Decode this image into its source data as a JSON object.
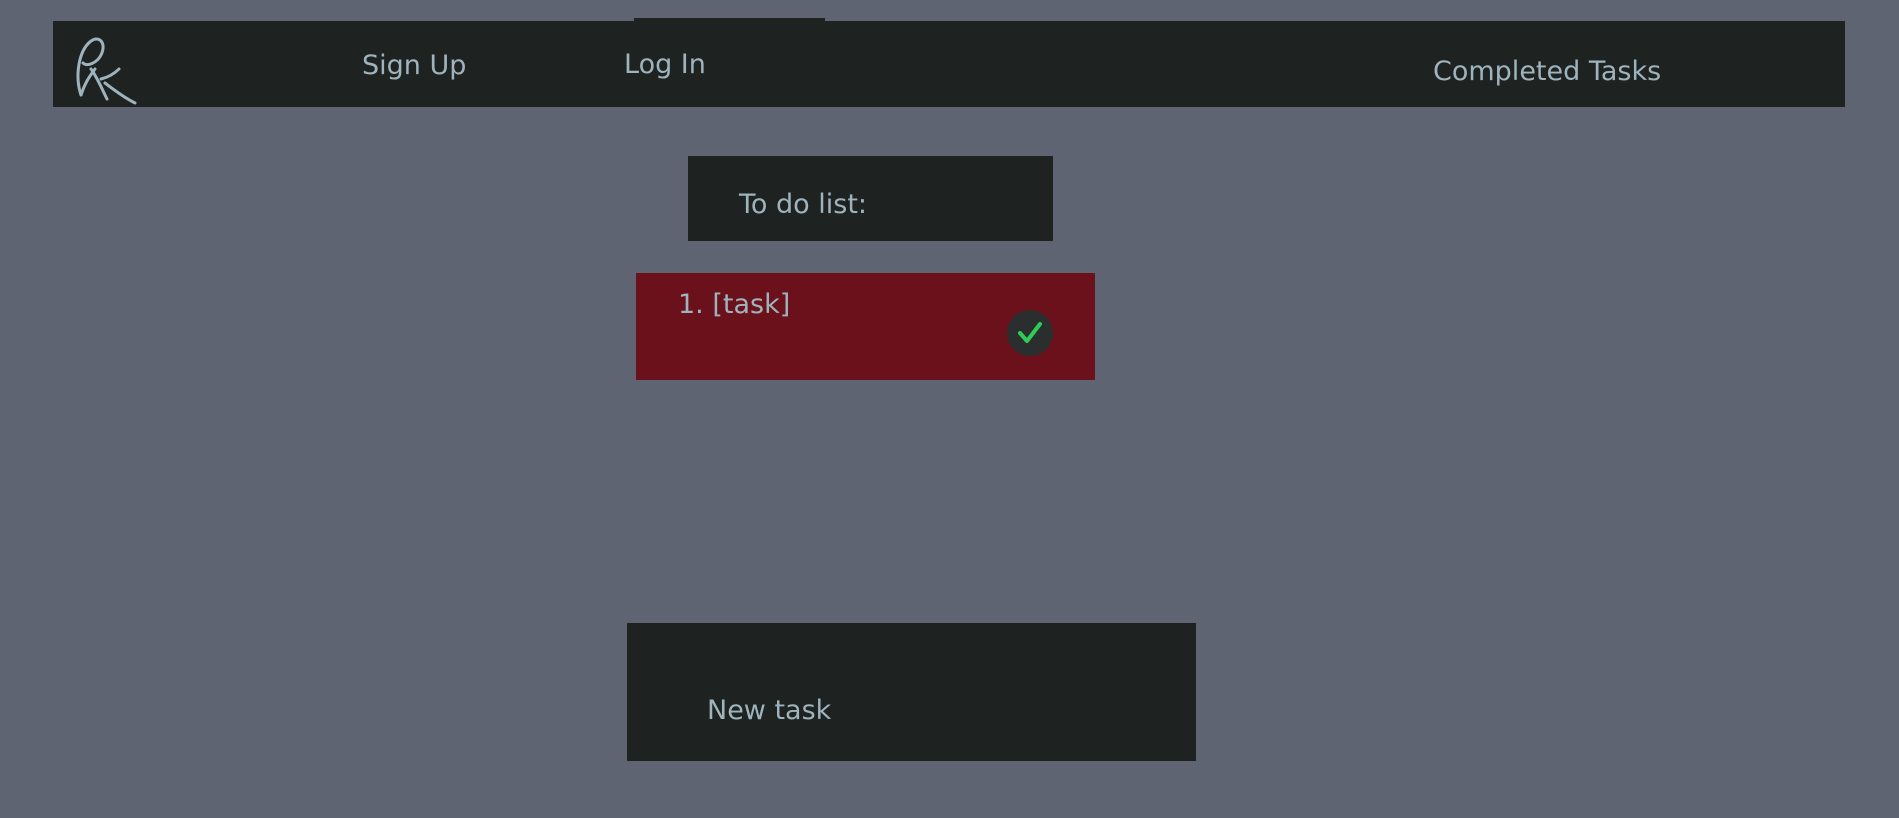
{
  "nav": {
    "logo": "logo-icon",
    "links": {
      "sign_up": "Sign Up",
      "log_in": "Log In",
      "completed_tasks": "Completed Tasks"
    },
    "active_link": "log_in"
  },
  "todo": {
    "header": "To do list:",
    "tasks": [
      {
        "label": "1. [task]",
        "action_icon": "check-icon"
      }
    ]
  },
  "new_task": {
    "placeholder": "New task"
  },
  "colors": {
    "background": "#5e6472",
    "panel": "#1e2322",
    "task_card": "#6b111b",
    "text": "#9fb3bd",
    "check": "#2ecc55"
  }
}
